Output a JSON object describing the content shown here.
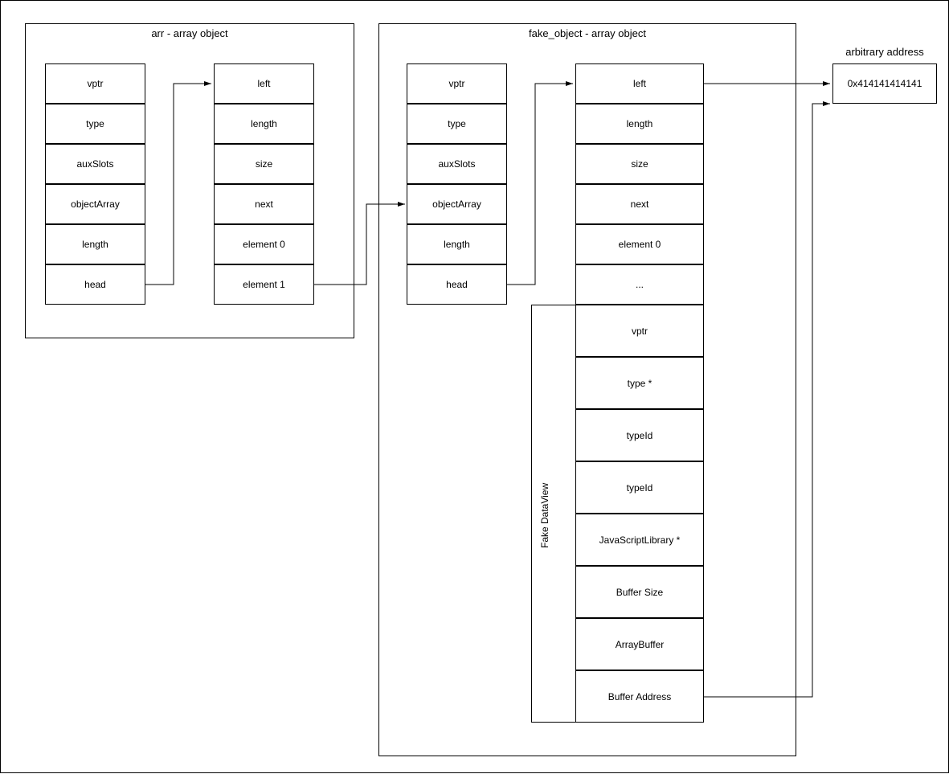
{
  "group_arr": {
    "title": "arr - array object",
    "col1": [
      "vptr",
      "type",
      "auxSlots",
      "objectArray",
      "length",
      "head"
    ],
    "col2": [
      "left",
      "length",
      "size",
      "next",
      "element 0",
      "element 1"
    ]
  },
  "group_fake": {
    "title": "fake_object - array object",
    "col1": [
      "vptr",
      "type",
      "auxSlots",
      "objectArray",
      "length",
      "head"
    ],
    "col2": [
      "left",
      "length",
      "size",
      "next",
      "element 0",
      "..."
    ],
    "dataview_label": "Fake DataView",
    "dataview": [
      "vptr",
      "type *",
      "typeId",
      "typeId",
      "JavaScriptLibrary *",
      "Buffer Size",
      "ArrayBuffer",
      "Buffer Address"
    ]
  },
  "arb": {
    "title": "arbitrary address",
    "value": "0x414141414141"
  }
}
